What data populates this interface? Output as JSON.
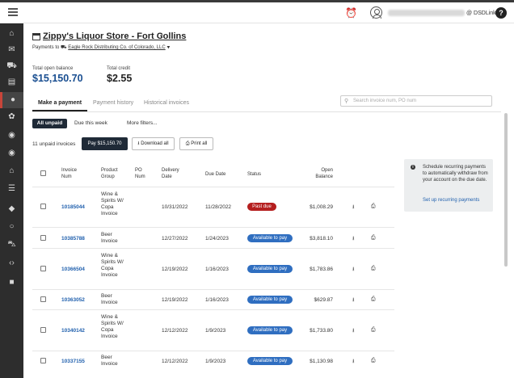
{
  "topbar": {
    "user_email": "",
    "tenant_label": "@ DSDLink ▾",
    "help_label": "?"
  },
  "header": {
    "store_name": "Zippy's Liquor Store - Fort Collins",
    "store_caret": "▾",
    "payments_to_prefix": "Payments to",
    "distributor": "Eagle Rock Distributing Co. of Colorado, LLC",
    "distributor_caret": "▾",
    "total_open_balance_label": "Total open balance",
    "total_open_balance": "$15,150.70",
    "total_credit_label": "Total credit",
    "total_credit": "$2.55"
  },
  "tabs": [
    {
      "label": "Make a payment"
    },
    {
      "label": "Payment history"
    },
    {
      "label": "Historical invoices"
    }
  ],
  "search": {
    "placeholder": "Search invoice num, PO num"
  },
  "filters": [
    "All unpaid",
    "Due this week",
    "More filters..."
  ],
  "actions": {
    "unpaid_count": "11 unpaid invoices",
    "pay_label": "Pay $15,150.70",
    "download_label": "Download all",
    "print_label": "Print all"
  },
  "table": {
    "headers": {
      "invoice_num": "Invoice Num",
      "product_group": "Product Group",
      "po_num": "PO Num",
      "delivery_date": "Delivery Date",
      "due_date": "Due Date",
      "status": "Status",
      "open_balance": "Open Balance"
    },
    "rows": [
      {
        "invoice": "10185044",
        "product": "Wine & Spirits W/ Copa Invoice",
        "po": "",
        "delivery": "10/31/2022",
        "due": "11/28/2022",
        "status": "Past due",
        "status_kind": "overdue",
        "balance": "$1,008.29"
      },
      {
        "invoice": "10385788",
        "product": "Beer Invoice",
        "po": "",
        "delivery": "12/27/2022",
        "due": "1/24/2023",
        "status": "Available to pay",
        "status_kind": "ok",
        "balance": "$3,818.10"
      },
      {
        "invoice": "10366504",
        "product": "Wine & Spirits W/ Copa Invoice",
        "po": "",
        "delivery": "12/19/2022",
        "due": "1/16/2023",
        "status": "Available to pay",
        "status_kind": "ok",
        "balance": "$1,783.86"
      },
      {
        "invoice": "10363052",
        "product": "Beer Invoice",
        "po": "",
        "delivery": "12/19/2022",
        "due": "1/16/2023",
        "status": "Available to pay",
        "status_kind": "ok",
        "balance": "$629.87"
      },
      {
        "invoice": "10340142",
        "product": "Wine & Spirits W/ Copa Invoice",
        "po": "",
        "delivery": "12/12/2022",
        "due": "1/9/2023",
        "status": "Available to pay",
        "status_kind": "ok",
        "balance": "$1,733.80"
      },
      {
        "invoice": "10337155",
        "product": "Beer Invoice",
        "po": "",
        "delivery": "12/12/2022",
        "due": "1/9/2023",
        "status": "Available to pay",
        "status_kind": "ok",
        "balance": "$1,130.98"
      }
    ]
  },
  "info_box": {
    "text": "Schedule recurring payments to automatically withdraw from your account on the due date.",
    "link": "Set up recurring payments"
  },
  "colors": {
    "sidebar_bg": "#2d2d2d",
    "primary_dark": "#1f2a37",
    "link_blue": "#1f5fad",
    "past_due_red": "#b51f1f",
    "available_blue": "#2f6ec0"
  }
}
